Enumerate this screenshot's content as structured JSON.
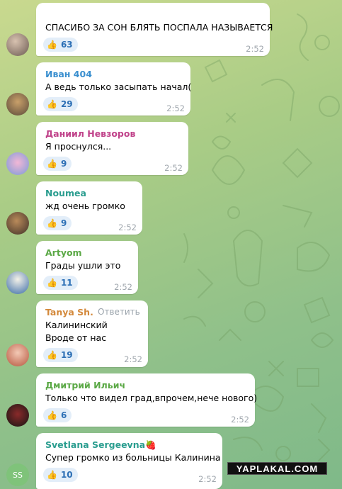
{
  "messages": [
    {
      "sender": "",
      "sender_color": "#ffffff",
      "lines": [
        "СПАСИБО ЗА СОН БЛЯТЬ ПОСПАЛА НАЗЫВАЕТСЯ"
      ],
      "reaction_count": "63",
      "time": "2:52",
      "avatar": "user-photo-avatar",
      "reply_label": ""
    },
    {
      "sender": "Иван 404",
      "sender_color": "#3a8fcf",
      "lines": [
        "А ведь только засыпать начал("
      ],
      "reaction_count": "29",
      "time": "2:52",
      "avatar": "user-photo-avatar",
      "reply_label": ""
    },
    {
      "sender": "Даниил Невзоров",
      "sender_color": "#c0428a",
      "lines": [
        "Я проснулся..."
      ],
      "reaction_count": "9",
      "time": "2:52",
      "avatar": "user-photo-avatar",
      "reply_label": ""
    },
    {
      "sender": "Noumea",
      "sender_color": "#2a9d8f",
      "lines": [
        "жд очень громко"
      ],
      "reaction_count": "9",
      "time": "2:52",
      "avatar": "user-photo-avatar",
      "reply_label": ""
    },
    {
      "sender": "Artyom",
      "sender_color": "#5aa845",
      "lines": [
        "Грады ушли это"
      ],
      "reaction_count": "11",
      "time": "2:52",
      "avatar": "user-photo-avatar",
      "reply_label": ""
    },
    {
      "sender": "Tanya Sh.",
      "sender_color": "#d3883a",
      "lines": [
        "Калининский",
        "Вроде от нас"
      ],
      "reaction_count": "19",
      "time": "2:52",
      "avatar": "user-photo-avatar",
      "reply_label": "Ответить"
    },
    {
      "sender": "Дмитрий Ильич",
      "sender_color": "#5aa845",
      "lines": [
        "Только что видел град,впрочем,нече нового)"
      ],
      "reaction_count": "6",
      "time": "2:52",
      "avatar": "user-photo-avatar",
      "reply_label": ""
    },
    {
      "sender": "Svetlana Sergeevna",
      "sender_color": "#2a9d8f",
      "lines": [
        "Супер громко из больницы Калинина"
      ],
      "reaction_count": "10",
      "time": "2:52",
      "avatar": "initials-avatar",
      "avatar_initials": "SS",
      "sender_emoji": "strawberry-icon",
      "reply_label": ""
    }
  ],
  "reaction_emoji": "thumbs-up-icon",
  "watermark": "YAPLAKAL.COM",
  "colors": {
    "background": "#a9cc86",
    "bubble": "#ffffff",
    "reaction_bg": "#e3eef9",
    "reaction_text": "#2c6fb5",
    "time": "#a0a7ae"
  }
}
